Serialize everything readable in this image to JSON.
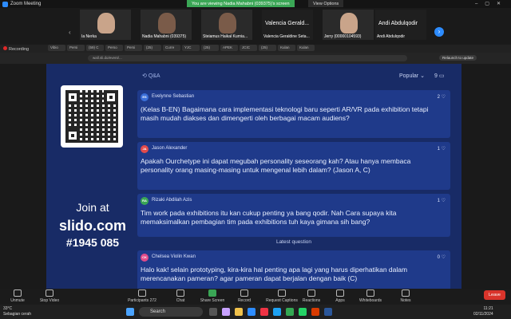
{
  "window": {
    "title": "Zoom Meeting"
  },
  "banner": {
    "viewing": "You are viewing Nadia Mahabni (039375)'s screen",
    "view_options": "View Options"
  },
  "gallery": {
    "tiles": [
      {
        "name": "Ia Nerka"
      },
      {
        "name": "Nadia Mahabni (039375)"
      },
      {
        "name": "Steiamus Haikal Kurnia..."
      },
      {
        "name": "Valencia Geraldine Seta...",
        "big": "Valencia  Gerald..."
      },
      {
        "name": "Jerry (00000104593)"
      },
      {
        "name": "Andi Abdulqodir",
        "big": "Andi Abdulqodir"
      }
    ]
  },
  "recording": {
    "label": "Recording"
  },
  "tabs": [
    "Vibio",
    "Persi",
    "(59) C",
    "Perso",
    "Persi",
    "(25)",
    "Curre",
    "YJC",
    "(25)",
    "APEK",
    "JCIC",
    "(25)",
    "Kulan",
    "Kulan"
  ],
  "browser": {
    "url": "wall.sli.do/event/...",
    "relaunch": "Relaunch to update"
  },
  "slido": {
    "join_line1": "Join at",
    "join_line2": "slido.com",
    "join_line3": "#1945 085",
    "qa_label": "Q&A",
    "sort_label": "Popular",
    "count": "9",
    "latest_label": "Latest question",
    "questions": [
      {
        "initials": "ES",
        "color": "#3b6fd9",
        "author": "Evelynne Sebastian",
        "likes": "2",
        "text": "(Kelas B-EN) Bagaimana cara implementasi teknologi baru seperti AR/VR pada exhibition tetapi masih mudah diakses dan dimengerti oleh berbagai macam audiens?"
      },
      {
        "initials": "JA",
        "color": "#e14b4b",
        "author": "Jason Alexander",
        "likes": "1",
        "text": "Apakah Ourchetype ini dapat megubah personality seseorang kah? Atau hanya membaca personality orang masing-masing untuk mengenal lebih dalam? (Jason A, C)"
      },
      {
        "initials": "RA",
        "color": "#3aa655",
        "author": "Rizaki Abdilah Azis",
        "likes": "1",
        "text": "Tim work pada exhibitions itu kan cukup penting ya bang qodir. Nah Cara supaya kita memaksimalkan pembagian tim pada exhibitions tuh kaya gimana sih bang?"
      },
      {
        "initials": "CK",
        "color": "#e14b8a",
        "author": "Chelsea Violin Kwan",
        "likes": "0",
        "text": "Halo kak! selain prototyping, kira-kira hal penting apa lagi yang harus diperhatikan dalam merencanakan pameran? agar pameran dapat berjalan dengan baik (C)"
      }
    ]
  },
  "controls": {
    "unmute": "Unmute",
    "stop_video": "Stop Video",
    "participants": "Participants",
    "participants_count": "272",
    "chat": "Chat",
    "share_screen": "Share Screen",
    "record": "Record",
    "request_captions": "Request Captions",
    "reactions": "Reactions",
    "apps": "Apps",
    "whiteboards": "Whiteboards",
    "notes": "Notes",
    "leave": "Leave"
  },
  "taskbar": {
    "temp": "33°C",
    "weather": "Sebagian cerah",
    "search": "Search",
    "time": "11:21",
    "date": "02/11/2024"
  }
}
